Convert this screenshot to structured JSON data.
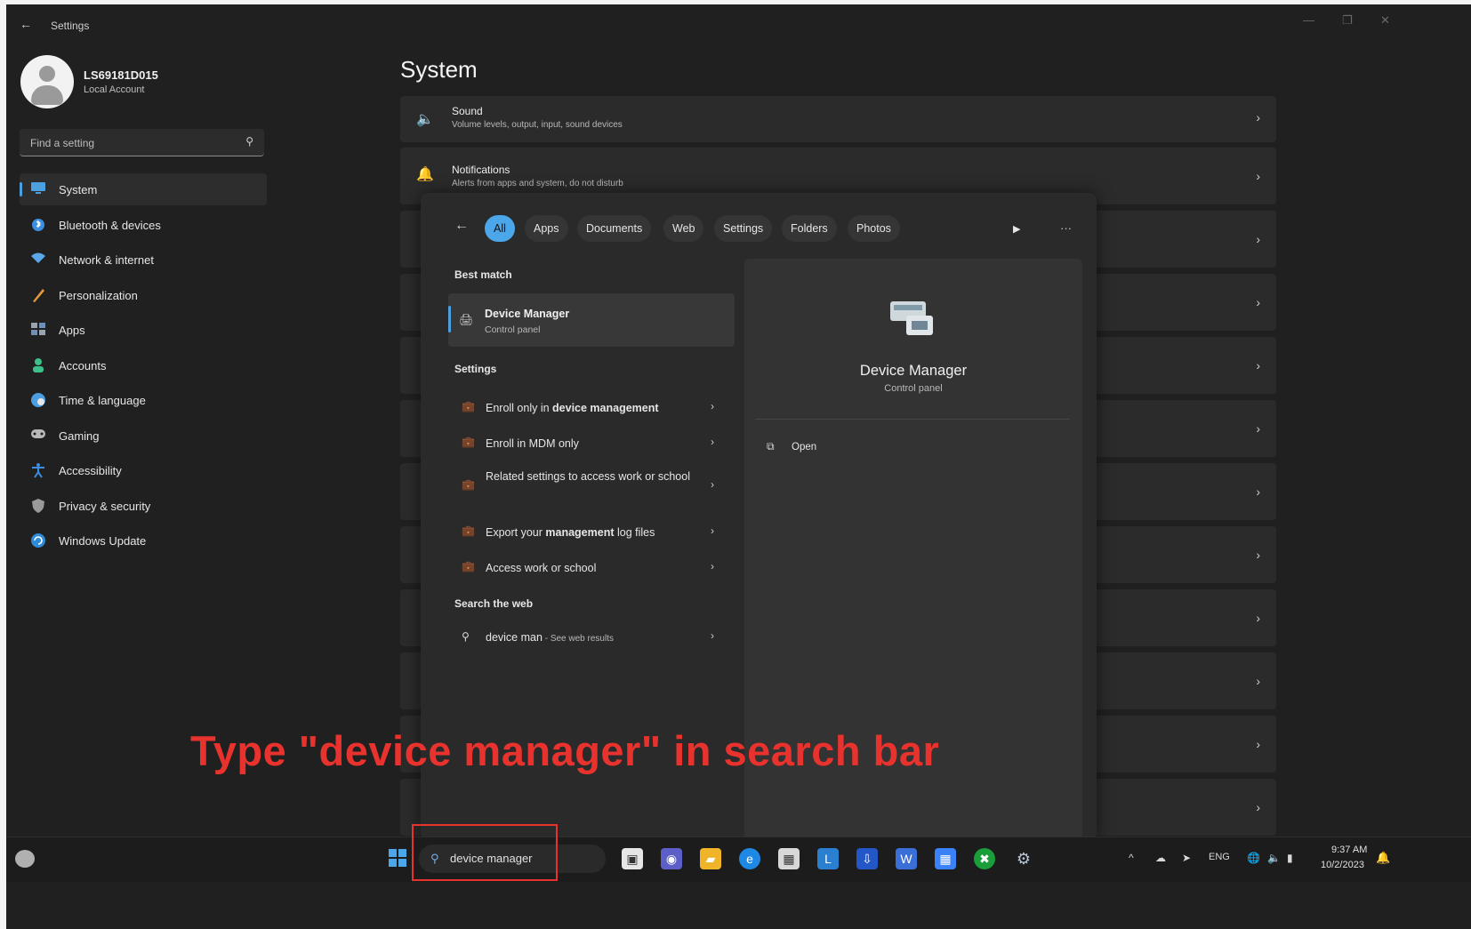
{
  "window": {
    "back_glyph": "←",
    "title": "Settings",
    "controls": [
      "—",
      "❐",
      "✕"
    ]
  },
  "profile": {
    "name": "LS69181D015",
    "type": "Local Account"
  },
  "find": {
    "placeholder": "Find a setting"
  },
  "nav": {
    "items": [
      {
        "label": "System",
        "icon": "monitor-icon",
        "color": "#4ca0e0",
        "active": true
      },
      {
        "label": "Bluetooth & devices",
        "icon": "bluetooth-icon",
        "color": "#3c8ee0"
      },
      {
        "label": "Network & internet",
        "icon": "wifi-icon",
        "color": "#5aa8ea"
      },
      {
        "label": "Personalization",
        "icon": "brush-icon",
        "color": "#e59a3a"
      },
      {
        "label": "Apps",
        "icon": "apps-icon",
        "color": "#9aa4b0"
      },
      {
        "label": "Accounts",
        "icon": "person-icon",
        "color": "#3cbf8a"
      },
      {
        "label": "Time & language",
        "icon": "globe-clock-icon",
        "color": "#4c9ee0"
      },
      {
        "label": "Gaming",
        "icon": "gamepad-icon",
        "color": "#b8b8b8"
      },
      {
        "label": "Accessibility",
        "icon": "accessibility-icon",
        "color": "#3c8ee0"
      },
      {
        "label": "Privacy & security",
        "icon": "shield-icon",
        "color": "#9a9a9a"
      },
      {
        "label": "Windows Update",
        "icon": "update-icon",
        "color": "#2f8ad8"
      }
    ]
  },
  "system": {
    "title": "System",
    "cards": [
      {
        "title": "Sound",
        "subtitle": "Volume levels, output, input, sound devices",
        "icon": "speaker-icon",
        "chevron": "›"
      },
      {
        "title": "Notifications",
        "subtitle": "Alerts from apps and system, do not disturb",
        "icon": "bell-icon",
        "chevron": "›"
      }
    ],
    "chevron": "›"
  },
  "search_panel": {
    "back": "←",
    "filters": [
      "All",
      "Apps",
      "Documents",
      "Web",
      "Settings",
      "Folders",
      "Photos"
    ],
    "active_filter": "All",
    "play": "▶",
    "more": "···",
    "best_match_heading": "Best match",
    "best_match": {
      "title": "Device Manager",
      "subtitle": "Control panel"
    },
    "settings_heading": "Settings",
    "settings_results": [
      {
        "pre": "Enroll only in ",
        "bold": "device management",
        "post": ""
      },
      {
        "pre": "Enroll in MDM only",
        "bold": "",
        "post": ""
      },
      {
        "pre": "Related settings to access work or school",
        "bold": "",
        "post": ""
      },
      {
        "pre": "Export your ",
        "bold": "management",
        "post": " log files"
      },
      {
        "pre": "Access work or school",
        "bold": "",
        "post": ""
      }
    ],
    "web_heading": "Search the web",
    "web_result": {
      "query": "device man",
      "hint": " - See web results"
    },
    "chevron": "›",
    "preview": {
      "title": "Device Manager",
      "subtitle": "Control panel",
      "open_label": "Open"
    }
  },
  "caption": "Type \"device manager\" in search bar",
  "taskbar": {
    "search_value": "device manager",
    "tray_lang": "ENG",
    "time": "9:37 AM",
    "date": "10/2/2023"
  }
}
